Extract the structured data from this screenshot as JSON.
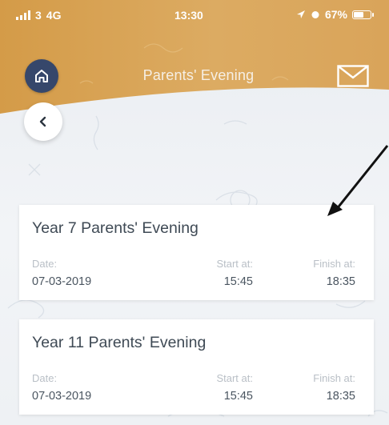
{
  "status_bar": {
    "carrier": "3",
    "network": "4G",
    "time": "13:30",
    "battery": "67%",
    "battery_level": 0.67
  },
  "header": {
    "title": "Parents' Evening",
    "home_icon": "home-icon",
    "mail_icon": "mail-icon",
    "back_icon": "chevron-left-icon"
  },
  "colors": {
    "header_brand": "#d6a052",
    "home_button": "#36476b",
    "card_bg": "#ffffff",
    "title_text": "#3f4a55",
    "label_text": "#b9bfc6",
    "annotation_arrow": "#111111"
  },
  "events": [
    {
      "title": "Year 7 Parents' Evening",
      "date_label": "Date:",
      "date_value": "07-03-2019",
      "start_label": "Start at:",
      "start_value": "15:45",
      "finish_label": "Finish at:",
      "finish_value": "18:35"
    },
    {
      "title": "Year 11 Parents' Evening",
      "date_label": "Date:",
      "date_value": "07-03-2019",
      "start_label": "Start at:",
      "start_value": "15:45",
      "finish_label": "Finish at:",
      "finish_value": "18:35"
    }
  ]
}
